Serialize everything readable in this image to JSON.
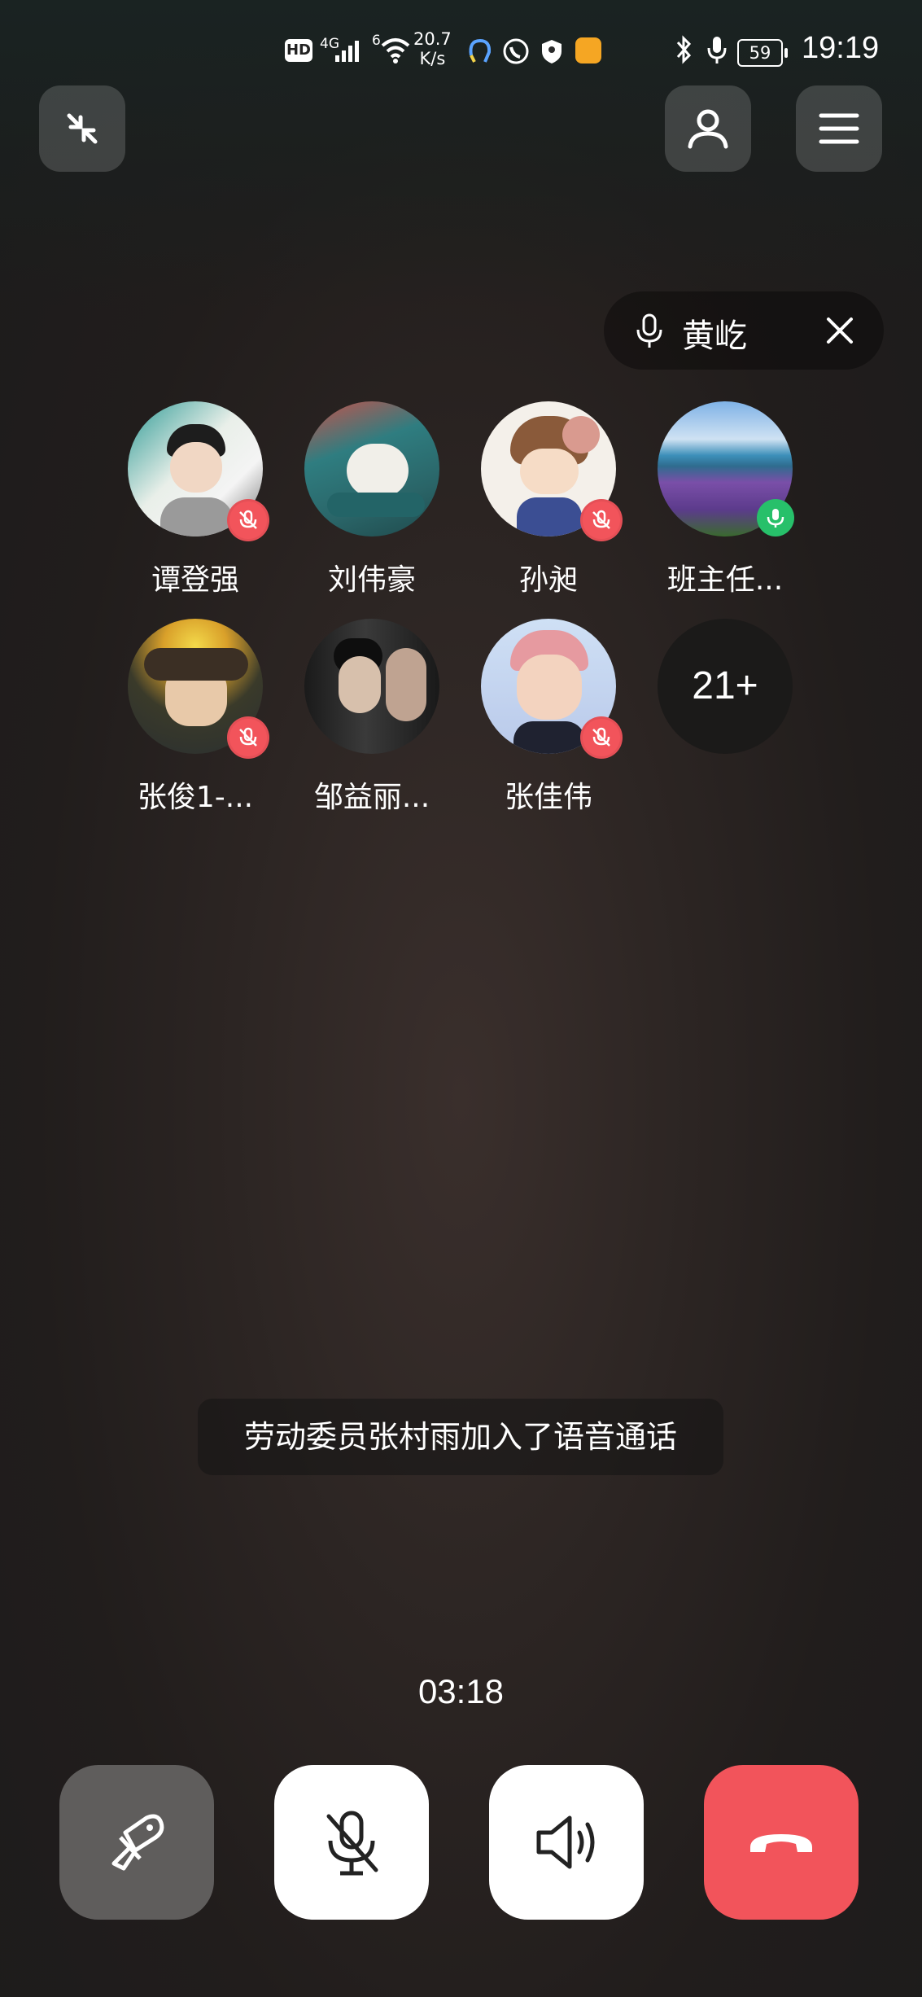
{
  "status_bar": {
    "hd_badge": "HD",
    "signal_1": "4G",
    "signal_2": "6",
    "net_speed_value": "20.7",
    "net_speed_unit": "K/s",
    "battery": "59",
    "time": "19:19"
  },
  "speaking": {
    "name": "黄屹"
  },
  "participants": [
    {
      "name": "谭登强",
      "muted": true
    },
    {
      "name": "刘伟豪",
      "muted": false
    },
    {
      "name": "孙昶",
      "muted": true
    },
    {
      "name": "班主任...",
      "speaking": true
    },
    {
      "name": "张俊1-...",
      "muted": true
    },
    {
      "name": "邹益丽...",
      "muted": false
    },
    {
      "name": "张佳伟",
      "muted": true
    }
  ],
  "more_count": "21+",
  "toast": "劳动委员张村雨加入了语音通话",
  "timer": "03:18",
  "colors": {
    "hangup": "#f2545b",
    "live": "#27c06a",
    "mute": "#f2545b"
  },
  "icons": [
    "collapse-icon",
    "person-icon",
    "menu-icon",
    "mic-icon",
    "close-icon",
    "screen-share-icon",
    "mic-off-icon",
    "speaker-icon",
    "hang-up-icon"
  ]
}
